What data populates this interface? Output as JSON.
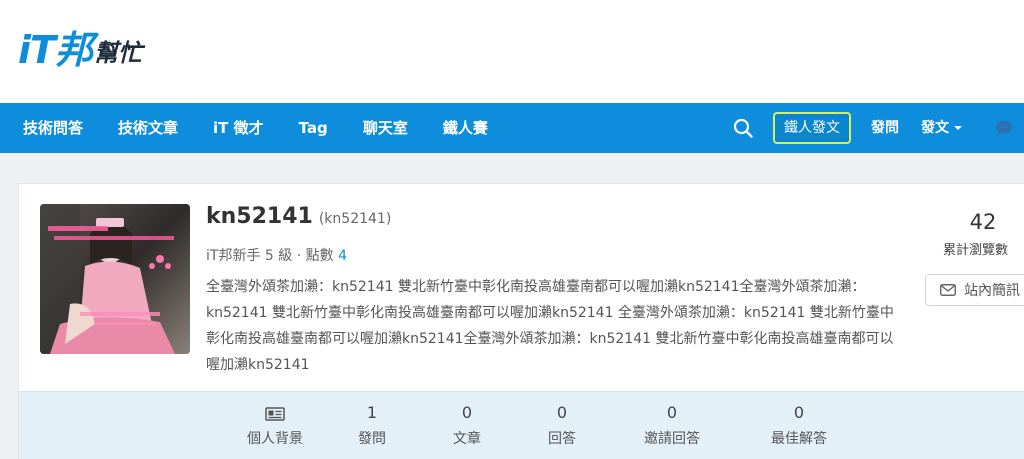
{
  "brand": {
    "logo_main": "iT邦",
    "logo_sub": "幫忙"
  },
  "nav": {
    "items": [
      {
        "label": "技術問答"
      },
      {
        "label": "技術文章"
      },
      {
        "label": "iT 徵才"
      },
      {
        "label": "Tag"
      },
      {
        "label": "聊天室"
      },
      {
        "label": "鐵人賽"
      }
    ],
    "ironman_post": "鐵人發文",
    "ask": "發問",
    "post": "發文"
  },
  "profile": {
    "username": "kn52141",
    "account": "(kn52141)",
    "rank_text": "iT邦新手 5 級 · 點數 ",
    "points": "4",
    "bio": "全臺灣外頌茶加瀨：kn52141 雙北新竹臺中彰化南投高雄臺南都可以喔加瀨kn52141全臺灣外頌茶加瀨：kn52141 雙北新竹臺中彰化南投高雄臺南都可以喔加瀨kn52141 全臺灣外頌茶加瀨：kn52141 雙北新竹臺中彰化南投高雄臺南都可以喔加瀨kn52141全臺灣外頌茶加瀨：kn52141 雙北新竹臺中彰化南投高雄臺南都可以喔加瀨kn52141",
    "views": "42",
    "views_label": "累計瀏覽數",
    "message_button": "站內簡訊"
  },
  "stats": [
    {
      "label": "個人背景",
      "value": "",
      "icon": "id-card-icon"
    },
    {
      "label": "發問",
      "value": "1"
    },
    {
      "label": "文章",
      "value": "0"
    },
    {
      "label": "回答",
      "value": "0"
    },
    {
      "label": "邀請回答",
      "value": "0"
    },
    {
      "label": "最佳解答",
      "value": "0"
    }
  ],
  "colors": {
    "brand_blue": "#0d8ddb",
    "ironman_border": "#d5f05a",
    "stats_bg": "#e4f0f8"
  }
}
